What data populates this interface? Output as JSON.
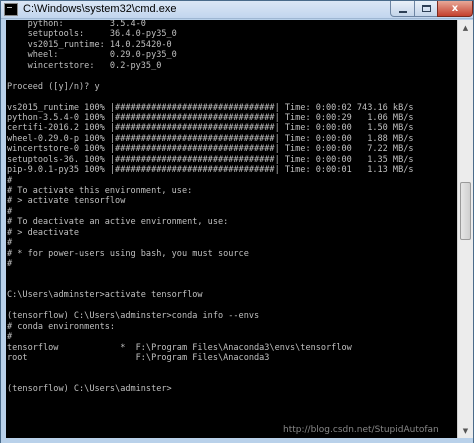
{
  "window": {
    "title": "C:\\Windows\\system32\\cmd.exe",
    "minimize_label": "",
    "maximize_label": "",
    "close_label": "x"
  },
  "console": {
    "lines": [
      "    python:         3.5.4-0",
      "    setuptools:     36.4.0-py35_0",
      "    vs2015_runtime: 14.0.25420-0",
      "    wheel:          0.29.0-py35_0",
      "    wincertstore:   0.2-py35_0",
      "",
      "Proceed ([y]/n)? y",
      "",
      "vs2015_runtime 100% |###############################| Time: 0:00:02 743.16 kB/s",
      "python-3.5.4-0 100% |###############################| Time: 0:00:29   1.06 MB/s",
      "certifi-2016.2 100% |###############################| Time: 0:00:00   1.50 MB/s",
      "wheel-0.29.0-p 100% |###############################| Time: 0:00:00   1.88 MB/s",
      "wincertstore-0 100% |###############################| Time: 0:00:00   7.22 MB/s",
      "setuptools-36. 100% |###############################| Time: 0:00:00   1.35 MB/s",
      "pip-9.0.1-py35 100% |###############################| Time: 0:00:01   1.13 MB/s",
      "#",
      "# To activate this environment, use:",
      "# > activate tensorflow",
      "#",
      "# To deactivate an active environment, use:",
      "# > deactivate",
      "#",
      "# * for power-users using bash, you must source",
      "#",
      "",
      "",
      "C:\\Users\\adminster>activate tensorflow",
      "",
      "(tensorflow) C:\\Users\\adminster>conda info --envs",
      "# conda environments:",
      "#",
      "tensorflow            *  F:\\Program Files\\Anaconda3\\envs\\tensorflow",
      "root                     F:\\Program Files\\Anaconda3",
      "",
      "",
      "(tensorflow) C:\\Users\\adminster>",
      "",
      "",
      "",
      ""
    ]
  },
  "scrollbar": {
    "up_arrow": "▲",
    "down_arrow": "▼"
  },
  "watermark": {
    "text": "http://blog.csdn.net/StupidAutofan"
  },
  "icons": {
    "app": "cmd-console-icon",
    "minimize": "minimize-icon",
    "maximize": "maximize-icon",
    "close": "close-icon"
  },
  "colors": {
    "console_background": "#000000",
    "console_text": "#c0c0c0",
    "title_bar": "#c2d6ee",
    "close_button": "#c4402d"
  }
}
